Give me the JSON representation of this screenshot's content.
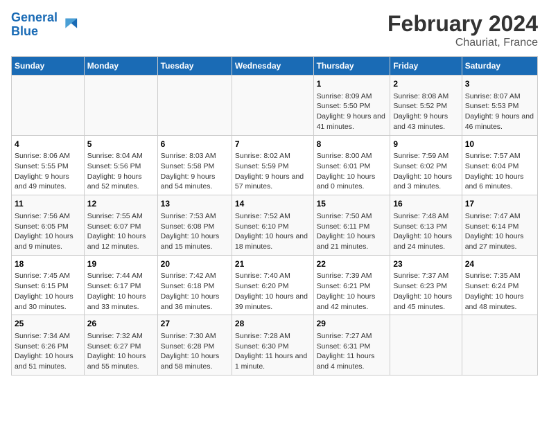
{
  "header": {
    "logo_line1": "General",
    "logo_line2": "Blue",
    "title": "February 2024",
    "subtitle": "Chauriat, France"
  },
  "days_of_week": [
    "Sunday",
    "Monday",
    "Tuesday",
    "Wednesday",
    "Thursday",
    "Friday",
    "Saturday"
  ],
  "weeks": [
    [
      {
        "num": "",
        "info": ""
      },
      {
        "num": "",
        "info": ""
      },
      {
        "num": "",
        "info": ""
      },
      {
        "num": "",
        "info": ""
      },
      {
        "num": "1",
        "info": "Sunrise: 8:09 AM\nSunset: 5:50 PM\nDaylight: 9 hours and 41 minutes."
      },
      {
        "num": "2",
        "info": "Sunrise: 8:08 AM\nSunset: 5:52 PM\nDaylight: 9 hours and 43 minutes."
      },
      {
        "num": "3",
        "info": "Sunrise: 8:07 AM\nSunset: 5:53 PM\nDaylight: 9 hours and 46 minutes."
      }
    ],
    [
      {
        "num": "4",
        "info": "Sunrise: 8:06 AM\nSunset: 5:55 PM\nDaylight: 9 hours and 49 minutes."
      },
      {
        "num": "5",
        "info": "Sunrise: 8:04 AM\nSunset: 5:56 PM\nDaylight: 9 hours and 52 minutes."
      },
      {
        "num": "6",
        "info": "Sunrise: 8:03 AM\nSunset: 5:58 PM\nDaylight: 9 hours and 54 minutes."
      },
      {
        "num": "7",
        "info": "Sunrise: 8:02 AM\nSunset: 5:59 PM\nDaylight: 9 hours and 57 minutes."
      },
      {
        "num": "8",
        "info": "Sunrise: 8:00 AM\nSunset: 6:01 PM\nDaylight: 10 hours and 0 minutes."
      },
      {
        "num": "9",
        "info": "Sunrise: 7:59 AM\nSunset: 6:02 PM\nDaylight: 10 hours and 3 minutes."
      },
      {
        "num": "10",
        "info": "Sunrise: 7:57 AM\nSunset: 6:04 PM\nDaylight: 10 hours and 6 minutes."
      }
    ],
    [
      {
        "num": "11",
        "info": "Sunrise: 7:56 AM\nSunset: 6:05 PM\nDaylight: 10 hours and 9 minutes."
      },
      {
        "num": "12",
        "info": "Sunrise: 7:55 AM\nSunset: 6:07 PM\nDaylight: 10 hours and 12 minutes."
      },
      {
        "num": "13",
        "info": "Sunrise: 7:53 AM\nSunset: 6:08 PM\nDaylight: 10 hours and 15 minutes."
      },
      {
        "num": "14",
        "info": "Sunrise: 7:52 AM\nSunset: 6:10 PM\nDaylight: 10 hours and 18 minutes."
      },
      {
        "num": "15",
        "info": "Sunrise: 7:50 AM\nSunset: 6:11 PM\nDaylight: 10 hours and 21 minutes."
      },
      {
        "num": "16",
        "info": "Sunrise: 7:48 AM\nSunset: 6:13 PM\nDaylight: 10 hours and 24 minutes."
      },
      {
        "num": "17",
        "info": "Sunrise: 7:47 AM\nSunset: 6:14 PM\nDaylight: 10 hours and 27 minutes."
      }
    ],
    [
      {
        "num": "18",
        "info": "Sunrise: 7:45 AM\nSunset: 6:15 PM\nDaylight: 10 hours and 30 minutes."
      },
      {
        "num": "19",
        "info": "Sunrise: 7:44 AM\nSunset: 6:17 PM\nDaylight: 10 hours and 33 minutes."
      },
      {
        "num": "20",
        "info": "Sunrise: 7:42 AM\nSunset: 6:18 PM\nDaylight: 10 hours and 36 minutes."
      },
      {
        "num": "21",
        "info": "Sunrise: 7:40 AM\nSunset: 6:20 PM\nDaylight: 10 hours and 39 minutes."
      },
      {
        "num": "22",
        "info": "Sunrise: 7:39 AM\nSunset: 6:21 PM\nDaylight: 10 hours and 42 minutes."
      },
      {
        "num": "23",
        "info": "Sunrise: 7:37 AM\nSunset: 6:23 PM\nDaylight: 10 hours and 45 minutes."
      },
      {
        "num": "24",
        "info": "Sunrise: 7:35 AM\nSunset: 6:24 PM\nDaylight: 10 hours and 48 minutes."
      }
    ],
    [
      {
        "num": "25",
        "info": "Sunrise: 7:34 AM\nSunset: 6:26 PM\nDaylight: 10 hours and 51 minutes."
      },
      {
        "num": "26",
        "info": "Sunrise: 7:32 AM\nSunset: 6:27 PM\nDaylight: 10 hours and 55 minutes."
      },
      {
        "num": "27",
        "info": "Sunrise: 7:30 AM\nSunset: 6:28 PM\nDaylight: 10 hours and 58 minutes."
      },
      {
        "num": "28",
        "info": "Sunrise: 7:28 AM\nSunset: 6:30 PM\nDaylight: 11 hours and 1 minute."
      },
      {
        "num": "29",
        "info": "Sunrise: 7:27 AM\nSunset: 6:31 PM\nDaylight: 11 hours and 4 minutes."
      },
      {
        "num": "",
        "info": ""
      },
      {
        "num": "",
        "info": ""
      }
    ]
  ]
}
